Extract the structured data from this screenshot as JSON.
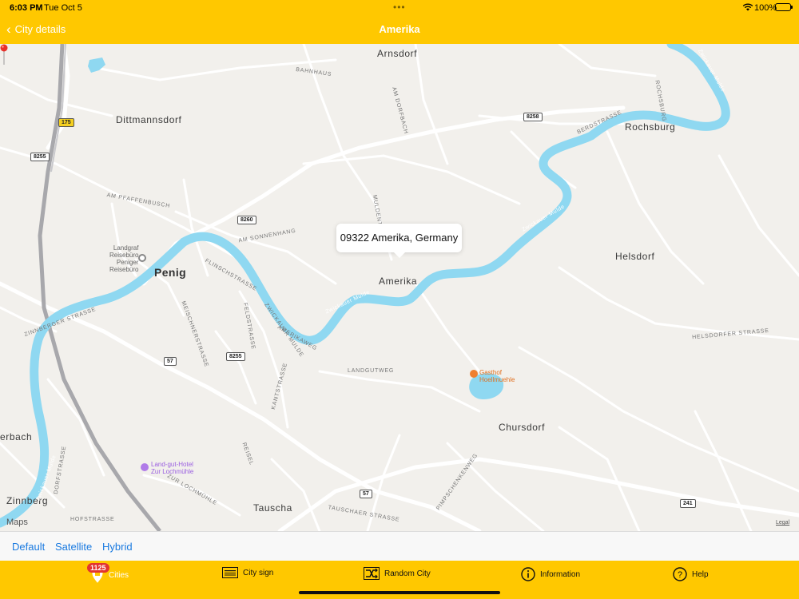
{
  "status_bar": {
    "time": "6:03 PM",
    "date": "Tue Oct 5",
    "battery": "100%"
  },
  "nav": {
    "back_label": "City details",
    "title": "Amerika"
  },
  "map": {
    "places": {
      "arnsdorf": "Arnsdorf",
      "dittmannsdorf": "Dittmannsdorf",
      "rochsburg": "Rochsburg",
      "penig": "Penig",
      "amerika": "Amerika",
      "helsdorf": "Helsdorf",
      "chursdorf": "Chursdorf",
      "erbach": "erbach",
      "zinnberg": "Zinnberg",
      "tauscha": "Tauscha"
    },
    "streets": {
      "bahnhaus": "BAHNHAUS",
      "am_dorfbach": "AM DORFBACH",
      "berdstrasse": "BERDSTRASSE",
      "am_pfaffenbusch": "AM PFAFFENBUSCH",
      "am_sonnenhang": "AM SONNENHANG",
      "muldentsl": "MULDENT",
      "flinschstrasse": "FLINSCHSTRASSE",
      "zinnberger": "ZINNBERGER STRASSE",
      "meischnerstrasse": "MEISCHNERSTRASSE",
      "feldstrasse": "FELDSTRASSE",
      "zwickauer_mulde_st": "ZWICKAUER MULDE",
      "amerikaweg": "AMERIKAWEG",
      "landgutweg": "LANDGUTWEG",
      "helsdorfer": "HELSDORFER STRASSE",
      "kantstrasse": "KANTSTRASSE",
      "reisel": "REISEL",
      "zur_lochmuehle": "ZUR LOCHMÜHLE",
      "dorfstrasse": "DORFSTRASSE",
      "pimpschenweg": "PIMPSCHENKENWEG",
      "tauschaer": "TAUSCHAER STRASSE",
      "hofstrasse": "HOFSTRASSE",
      "rochsburg_str": "ROCHSBURG"
    },
    "rivers": {
      "r1": "Zwickauer Mulde",
      "r2": "Zwickauer Mulde",
      "r3": "Zwickauer Mulde",
      "r4": "Zwickauer Mulde"
    },
    "shields": {
      "s175": "175",
      "s8255a": "8255",
      "s8258": "8258",
      "s8260": "8260",
      "s8255b": "8255",
      "s57a": "57",
      "s57b": "57",
      "s241": "241"
    },
    "pois": {
      "landgraf": "Landgraf\nReisebüro\nPeniger\nReisebüro",
      "gasthof": "Gasthof\nHoellmuehle",
      "landgut": "Land-gut-Hotel\nZur Lochmühle"
    },
    "callout": "09322 Amerika, Germany",
    "attribution": "Maps",
    "legal": "Legal",
    "colors": {
      "water": "#8fd8f1",
      "land": "#f2f0ec",
      "road": "#ffffff",
      "railway": "#a8a8ac",
      "pin": "#e8302a"
    }
  },
  "map_types": {
    "default": "Default",
    "satellite": "Satellite",
    "hybrid": "Hybrid"
  },
  "tabs": {
    "cities": "Cities",
    "cities_badge": "1125",
    "city_sign": "City sign",
    "random_city": "Random City",
    "information": "Information",
    "help": "Help"
  },
  "theme": {
    "accent": "#ffc800",
    "link": "#1a7ae0"
  }
}
